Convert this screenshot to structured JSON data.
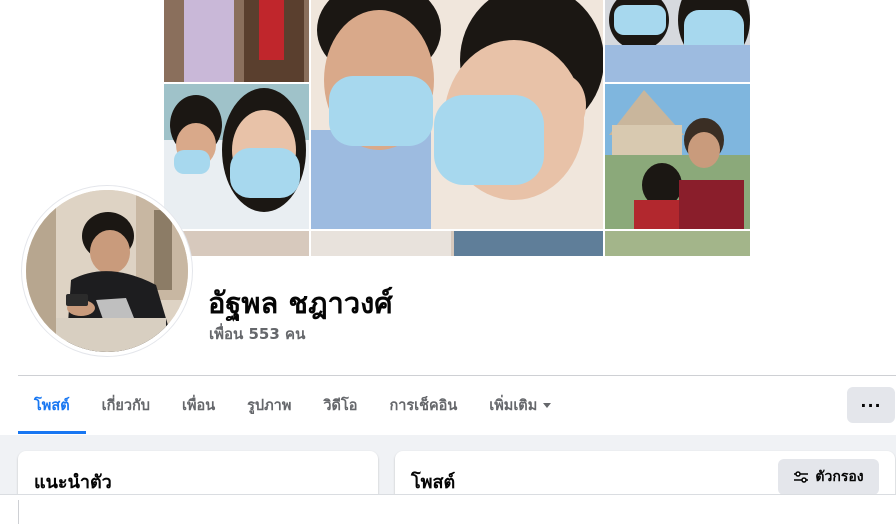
{
  "profile": {
    "name": "อัฐพล ชฎาวงศ์",
    "friends_text": "เพื่อน 553 คน"
  },
  "tabs": [
    {
      "label": "โพสต์",
      "active": true
    },
    {
      "label": "เกี่ยวกับ",
      "active": false
    },
    {
      "label": "เพื่อน",
      "active": false
    },
    {
      "label": "รูปภาพ",
      "active": false
    },
    {
      "label": "วิดีโอ",
      "active": false
    },
    {
      "label": "การเช็คอิน",
      "active": false
    },
    {
      "label": "เพิ่มเติม",
      "active": false
    }
  ],
  "more_button": "···",
  "intro_card": {
    "title": "แนะนำตัว"
  },
  "posts_card": {
    "title": "โพสต์",
    "filter_label": "ตัวกรอง"
  },
  "colors": {
    "accent": "#1877f2",
    "secondary_text": "#65676b",
    "button_bg": "#e4e6eb",
    "feed_bg": "#f0f2f5"
  },
  "icons": [
    "more-options-icon",
    "dropdown-caret-icon",
    "filter-sliders-icon"
  ]
}
